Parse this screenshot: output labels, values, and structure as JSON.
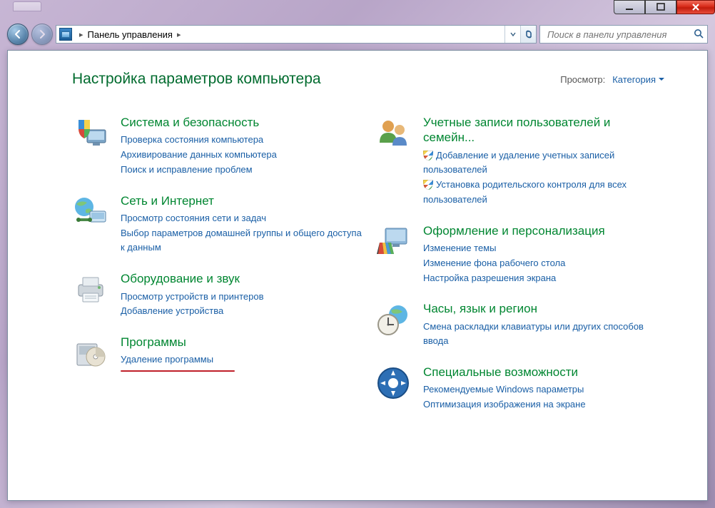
{
  "window": {
    "breadcrumb_location": "Панель управления",
    "search_placeholder": "Поиск в панели управления"
  },
  "header": {
    "title": "Настройка параметров компьютера",
    "view_label": "Просмотр:",
    "view_value": "Категория"
  },
  "left": [
    {
      "icon": "shield-monitor",
      "title": "Система и безопасность",
      "links": [
        {
          "text": "Проверка состояния компьютера"
        },
        {
          "text": "Архивирование данных компьютера"
        },
        {
          "text": "Поиск и исправление проблем"
        }
      ]
    },
    {
      "icon": "network-globe",
      "title": "Сеть и Интернет",
      "links": [
        {
          "text": "Просмотр состояния сети и задач"
        },
        {
          "text": "Выбор параметров домашней группы и общего доступа к данным"
        }
      ]
    },
    {
      "icon": "printer",
      "title": "Оборудование и звук",
      "links": [
        {
          "text": "Просмотр устройств и принтеров"
        },
        {
          "text": "Добавление устройства"
        }
      ]
    },
    {
      "icon": "disc-box",
      "title": "Программы",
      "links": [
        {
          "text": "Удаление программы"
        }
      ],
      "annotated": true
    }
  ],
  "right": [
    {
      "icon": "users",
      "title": "Учетные записи пользователей и семейн...",
      "links": [
        {
          "text": "Добавление и удаление учетных записей пользователей",
          "shield": true
        },
        {
          "text": "Установка родительского контроля для всех пользователей",
          "shield": true
        }
      ]
    },
    {
      "icon": "appearance",
      "title": "Оформление и персонализация",
      "links": [
        {
          "text": "Изменение темы"
        },
        {
          "text": "Изменение фона рабочего стола"
        },
        {
          "text": "Настройка разрешения экрана"
        }
      ]
    },
    {
      "icon": "clock-globe",
      "title": "Часы, язык и регион",
      "links": [
        {
          "text": "Смена раскладки клавиатуры или других способов ввода"
        }
      ]
    },
    {
      "icon": "ease-access",
      "title": "Специальные возможности",
      "links": [
        {
          "text": "Рекомендуемые Windows параметры"
        },
        {
          "text": "Оптимизация изображения на экране"
        }
      ]
    }
  ]
}
